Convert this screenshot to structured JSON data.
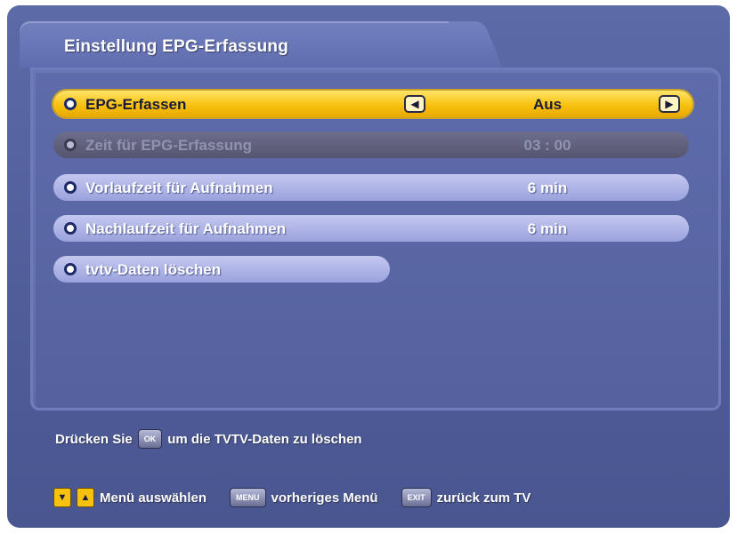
{
  "title": "Einstellung EPG-Erfassung",
  "menu": {
    "items": [
      {
        "label": "EPG-Erfassen",
        "value": "Aus"
      },
      {
        "label": "Zeit für EPG-Erfassung",
        "value": "03 : 00"
      },
      {
        "label": "Vorlaufzeit für Aufnahmen",
        "value": "6 min"
      },
      {
        "label": "Nachlaufzeit für Aufnahmen",
        "value": "6 min"
      },
      {
        "label": "tvtv-Daten löschen"
      }
    ]
  },
  "hint": {
    "prefix": "Drücken Sie",
    "key": "OK",
    "suffix": "um die TVTV-Daten zu löschen"
  },
  "legend": {
    "navigate_label": "Menü auswählen",
    "menu_key": "MENU",
    "menu_label": "vorheriges Menü",
    "exit_key": "EXIT",
    "exit_label": "zurück zum TV"
  },
  "colors": {
    "selected": "#f7c10e",
    "background": "#5c6aa8",
    "item": "#aeb4e6",
    "disabled": "#60607c"
  },
  "icons": {
    "left": "left-arrow-icon",
    "right": "right-arrow-icon",
    "up": "up-arrow-icon",
    "down": "down-arrow-icon"
  }
}
